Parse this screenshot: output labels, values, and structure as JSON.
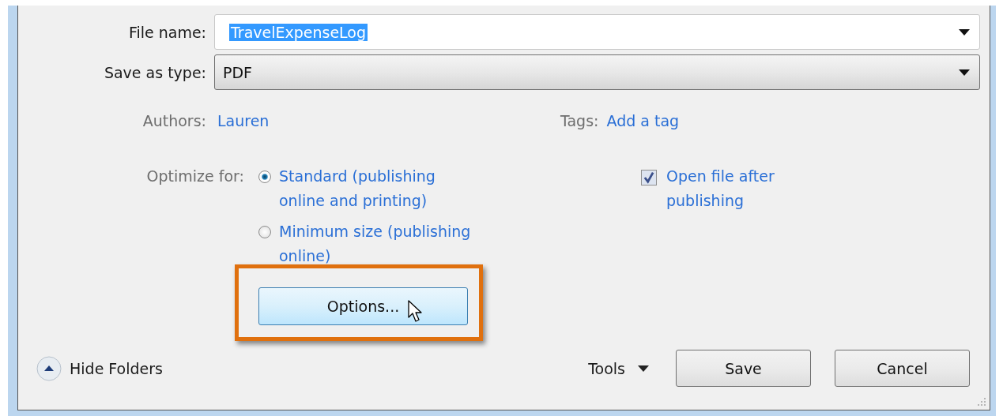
{
  "fields": [
    {
      "label": "File name:",
      "kind": "combo",
      "value": "TravelExpenseLog",
      "text_selected": true
    },
    {
      "label": "Save as type:",
      "kind": "dropdown",
      "value": "PDF",
      "text_selected": false
    }
  ],
  "authors": {
    "label": "Authors:",
    "value": "Lauren"
  },
  "tags": {
    "label": "Tags:",
    "value": "Add a tag"
  },
  "optimize": {
    "label": "Optimize for:",
    "options": [
      {
        "label": "Standard (publishing online and printing)",
        "selected": true
      },
      {
        "label": "Minimum size (publishing online)",
        "selected": false
      }
    ]
  },
  "open_after": {
    "label": "Open file after publishing",
    "checked": true
  },
  "options_button": {
    "label": "Options...",
    "highlighted": true
  },
  "hide_folders": "Hide Folders",
  "tools": "Tools",
  "buttons": [
    "Save",
    "Cancel"
  ]
}
